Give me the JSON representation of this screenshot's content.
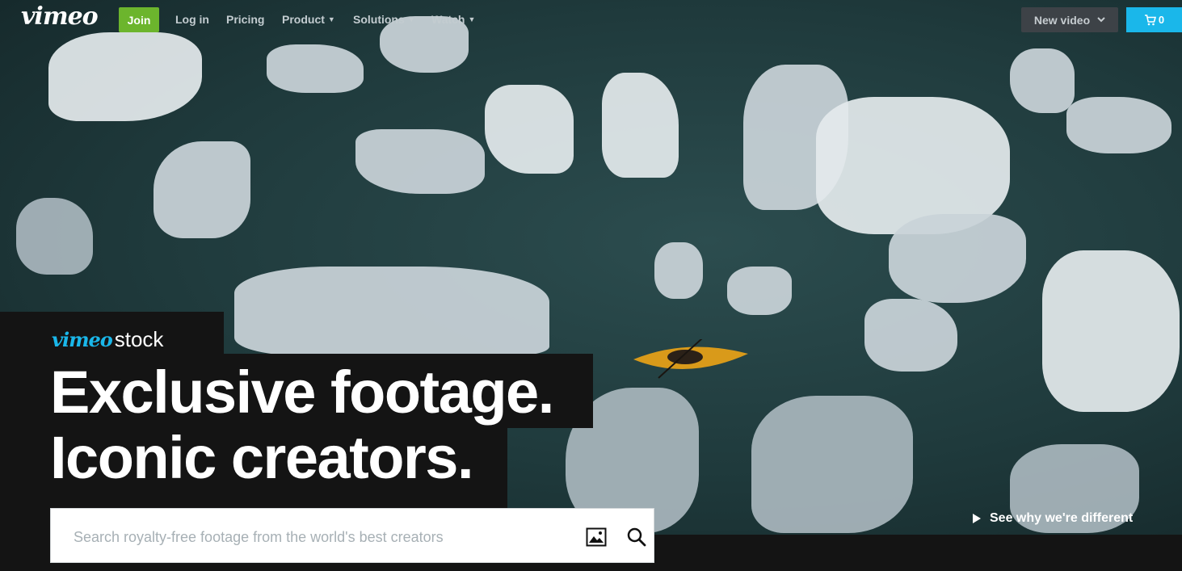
{
  "nav": {
    "logo": "vimeo",
    "join": "Join",
    "links": [
      {
        "label": "Log in",
        "dropdown": false
      },
      {
        "label": "Pricing",
        "dropdown": false
      },
      {
        "label": "Product",
        "dropdown": true
      },
      {
        "label": "Solutions",
        "dropdown": true
      },
      {
        "label": "Watch",
        "dropdown": true
      }
    ],
    "new_video": "New video",
    "cart_count": "0"
  },
  "hero": {
    "brand_vimeo": "vimeo",
    "brand_stock": "stock",
    "headline_1": "Exclusive footage.",
    "headline_2": "Iconic creators.",
    "search_placeholder": "Search royalty-free footage from the world's best creators",
    "cta": "See why we're different"
  },
  "colors": {
    "join_green": "#6cb52d",
    "vimeo_blue": "#1ab7ea",
    "dark_panel": "#141414",
    "new_video_bg": "#3d4247"
  },
  "icons": [
    "image-search-icon",
    "magnifier-icon",
    "cart-icon",
    "chevron-down-icon",
    "play-icon"
  ]
}
